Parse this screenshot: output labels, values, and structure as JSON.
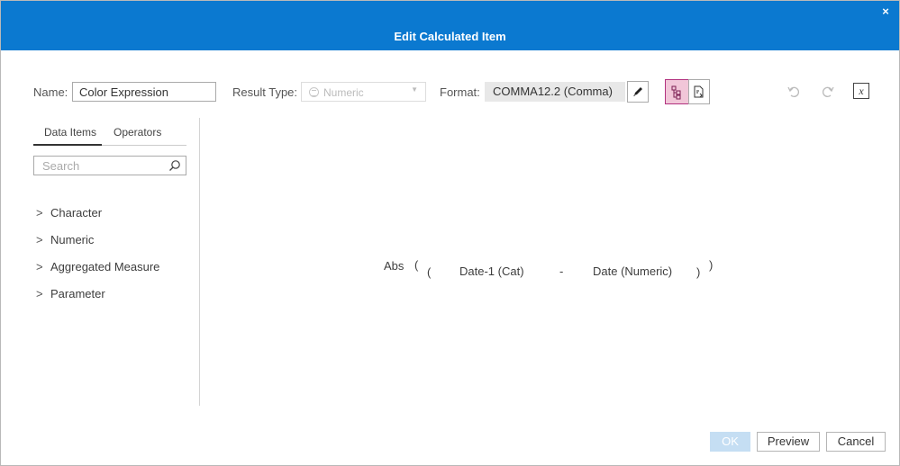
{
  "dialog": {
    "title": "Edit Calculated Item",
    "close_glyph": "×"
  },
  "toolbar": {
    "name_label": "Name:",
    "name_value": "Color Expression",
    "result_type_label": "Result Type:",
    "result_type_value": "Numeric",
    "format_label": "Format:",
    "format_value": "COMMA12.2 (Comma)"
  },
  "left_panel": {
    "tabs": [
      {
        "label": "Data Items",
        "active": true
      },
      {
        "label": "Operators",
        "active": false
      }
    ],
    "search_placeholder": "Search",
    "items": [
      {
        "label": "Character"
      },
      {
        "label": "Numeric"
      },
      {
        "label": "Aggregated Measure"
      },
      {
        "label": "Parameter"
      }
    ]
  },
  "expression": {
    "function": "Abs",
    "open_outer": "(",
    "open_inner": "(",
    "left_operand": "Date-1 (Cat)",
    "operator": "-",
    "right_operand": "Date (Numeric)",
    "close_inner": ")",
    "close_outer": ")"
  },
  "footer": {
    "ok_label": "OK",
    "preview_label": "Preview",
    "cancel_label": "Cancel"
  },
  "colors": {
    "title_bar": "#0b79d0",
    "active_toggle_border": "#b2327f",
    "active_toggle_fill": "#f1c6d8",
    "ok_disabled": "#c5def3"
  },
  "icons": {
    "close": "close-icon",
    "format_edit": "pencil-icon",
    "tree_view": "tree-view-icon",
    "text_view": "text-view-icon",
    "undo": "undo-icon",
    "redo": "redo-icon",
    "formula": "formula-icon",
    "search": "search-icon",
    "expand": "chevron-right-icon"
  }
}
